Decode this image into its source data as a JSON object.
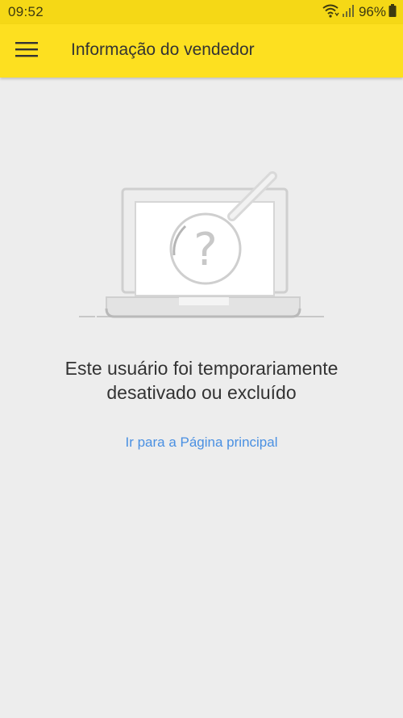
{
  "status_bar": {
    "time": "09:52",
    "battery": "96%",
    "icons": [
      "wifi-icon",
      "signal-icon",
      "battery-icon"
    ]
  },
  "app_bar": {
    "menu_icon": "hamburger-menu-icon",
    "title": "Informação do vendedor"
  },
  "main": {
    "illustration_icon": "laptop-question-magnifier-icon",
    "message": "Este usuário foi temporariamente desativado ou excluído",
    "home_link": "Ir para a Página principal"
  },
  "colors": {
    "accent": "#fde020",
    "status_bar": "#f5d816",
    "link": "#4a90e2",
    "background": "#ededed"
  }
}
